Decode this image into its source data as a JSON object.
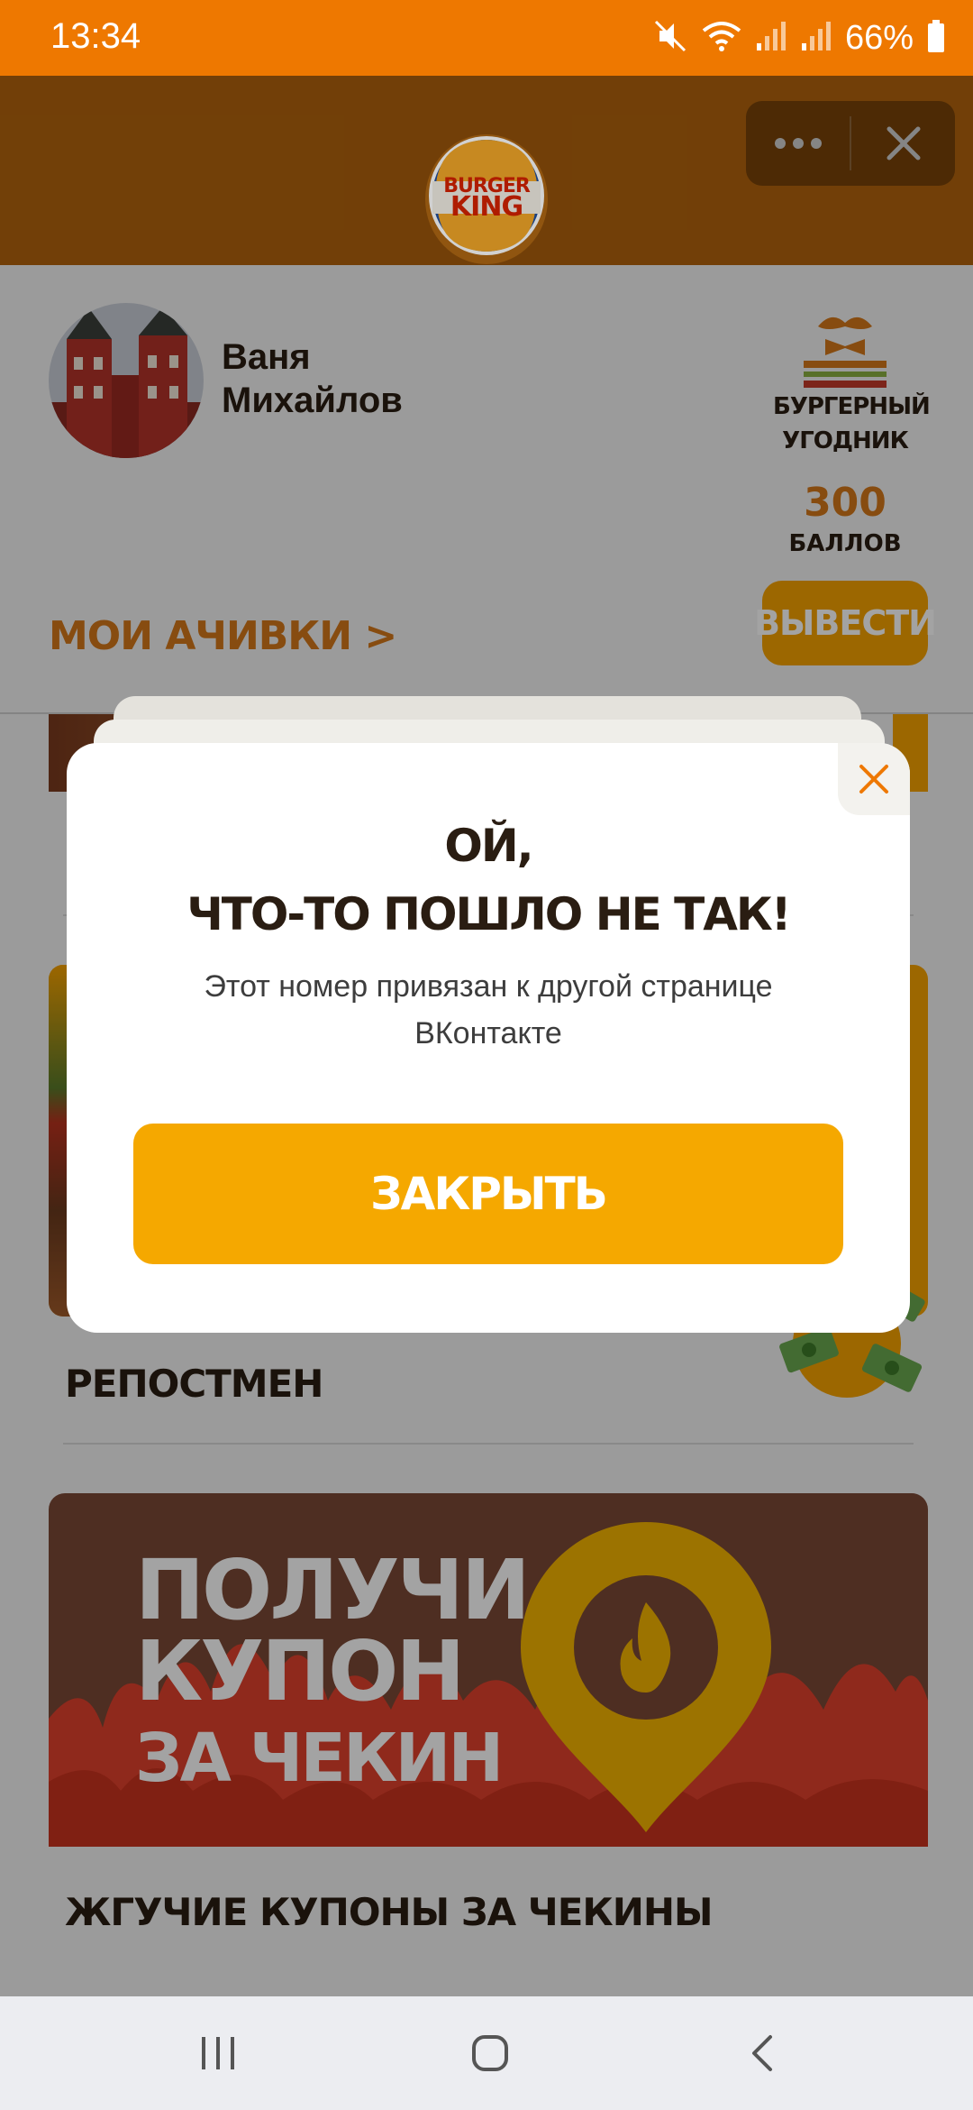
{
  "status_bar": {
    "time": "13:34",
    "battery": "66%"
  },
  "profile": {
    "name_first": "Ваня",
    "name_last": "Михайлов",
    "rank_line1": "БУРГЕРНЫЙ",
    "rank_line2": "УГОДНИК",
    "points": "300",
    "points_label": "БАЛЛОВ",
    "withdraw_label": "ВЫВЕСТИ",
    "achievements_label": "МОИ АЧИВКИ >"
  },
  "cards": {
    "repost_title": "РЕПОСТМЕН",
    "coupon_banner": [
      "ПОЛУЧИ",
      "КУПОН",
      "ЗА ЧЕКИН"
    ],
    "coupon_title": "ЖГУЧИЕ КУПОНЫ ЗА ЧЕКИНЫ"
  },
  "modal": {
    "title_line1": "ОЙ,",
    "title_line2": "ЧТО-ТО ПОШЛО НЕ ТАК!",
    "message": "Этот номер привязан к другой странице ВКонтакте",
    "close_button": "ЗАКРЫТЬ"
  },
  "colors": {
    "status_bar": "#ee7800",
    "header": "#d97a10",
    "accent_orange": "#f5a800",
    "brand_text_orange": "#d3781a",
    "dark_text": "#2a1d12"
  },
  "icons": [
    "mute-icon",
    "wifi-icon",
    "signal-icon",
    "battery-icon",
    "more-icon",
    "close-icon",
    "burger-king-logo",
    "mustache-bowtie-icon",
    "money-bag-icon",
    "location-pin-icon",
    "fire-icon",
    "recent-apps-icon",
    "home-icon",
    "back-icon"
  ]
}
